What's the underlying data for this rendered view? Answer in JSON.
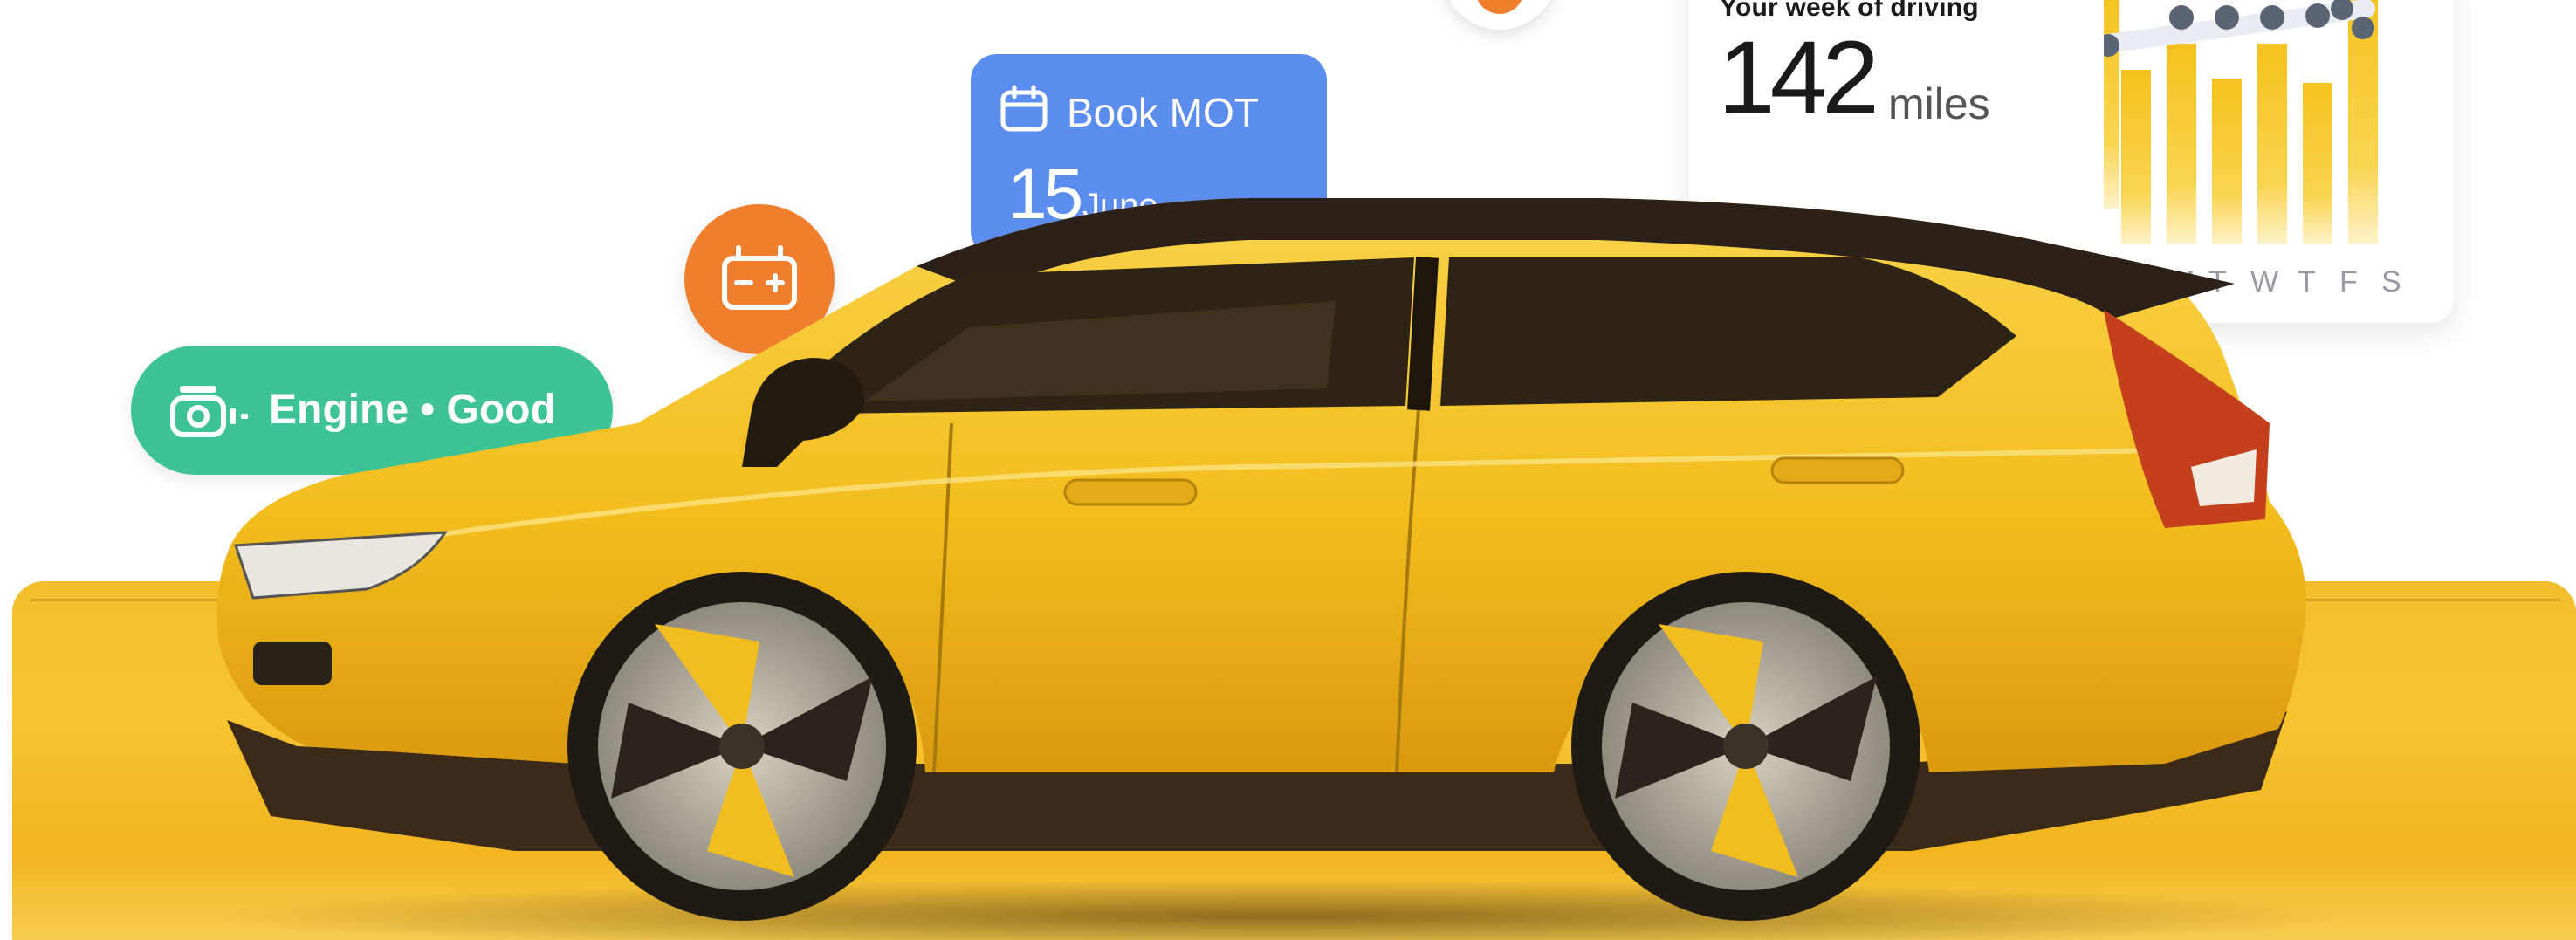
{
  "driving_card": {
    "subtitle": "Your week of driving",
    "miles_value": "142",
    "miles_unit": "miles",
    "days": [
      "M",
      "T",
      "W",
      "T",
      "F",
      "S"
    ],
    "colors": {
      "bar": "#f5c21c",
      "dot": "#5a6475"
    }
  },
  "mot_card": {
    "title": "Book MOT",
    "day": "15",
    "month": "June",
    "arrow": "›",
    "color": "#5b8def"
  },
  "battery_bubble": {
    "icon": "battery-icon",
    "color": "#f07f2d"
  },
  "engine_status": {
    "icon": "engine-icon",
    "label": "Engine • Good",
    "color": "#3ec494"
  },
  "car": {
    "body_color": "#f5c21c",
    "roof_color": "#2b2118"
  }
}
